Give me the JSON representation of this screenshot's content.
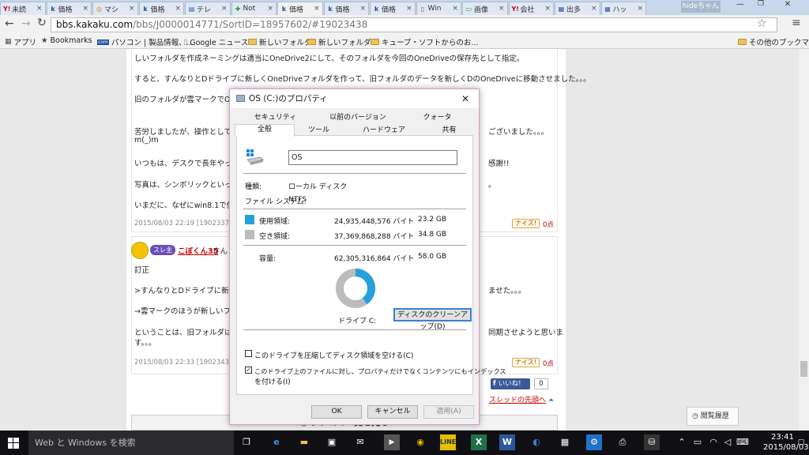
{
  "browser": {
    "tabs": [
      {
        "label": "未読",
        "favicon": "Y!",
        "color": "#d0021b"
      },
      {
        "label": "価格",
        "favicon": "k",
        "color": "#1a4fa0"
      },
      {
        "label": "マシ",
        "favicon": "◎",
        "color": "#e07b00"
      },
      {
        "label": "価格",
        "favicon": "k",
        "color": "#1a4fa0"
      },
      {
        "label": "テレ",
        "favicon": "▤",
        "color": "#2b64b8"
      },
      {
        "label": "Not",
        "favicon": "✚",
        "color": "#2a9d3a"
      },
      {
        "label": "価格",
        "favicon": "k",
        "color": "#1a4fa0"
      },
      {
        "label": "価格",
        "favicon": "k",
        "color": "#1a4fa0"
      },
      {
        "label": "価格",
        "favicon": "k",
        "color": "#1a4fa0"
      },
      {
        "label": "Win",
        "favicon": "▯",
        "color": "#666666"
      },
      {
        "label": "画像",
        "favicon": "▭",
        "color": "#2a9d3a"
      },
      {
        "label": "会社",
        "favicon": "Y!",
        "color": "#d0021b"
      },
      {
        "label": "出多",
        "favicon": "▦",
        "color": "#3355aa"
      },
      {
        "label": "ハッ",
        "favicon": "▦",
        "color": "#3355aa"
      }
    ],
    "active_tab_index": 6,
    "profile_name": "hideちゃん",
    "url_host": "bbs.kakaku.com",
    "url_path": "/bbs/J0000014771/SortID=18957602/#19023438",
    "bookmarks": [
      "アプリ",
      "Bookmarks",
      "パソコン | 製品情報、...",
      "Google ニュース",
      "新しいフォルダ",
      "新しいフォルダ2",
      "キューブ・ソフトからのお...",
      "その他のブックマーク"
    ]
  },
  "page": {
    "post1": {
      "lines": [
        "しいフォルダを作成ネーミングは適当にOneDrive2にして、そのフォルダを今回のOneDriveの保存先として指定。",
        "すると、すんなりとDドライブに新しくOneDriveフォルダを作って、旧フォルダのデータを新しくDのOneDriveに移動させました。。。",
        "旧のフォルダが雲マークでOne",
        "苦労しましたが、操作としては",
        "m(_)m",
        "いつもは、デスクで長年やって",
        "写真は、シンボリックといってい",
        "いまだに、なぜにwin8.1で使え"
      ],
      "line1_tail": "ございました。。。",
      "line2_tail": "感謝!!",
      "line3_tail": "。",
      "meta": "2015/08/03 22:19 [19023379]",
      "nice_label": "ナイス!",
      "nice_count": "0点"
    },
    "post2": {
      "badge": "スレ主",
      "author": "こぼくん35",
      "author_suffix": "さん",
      "lines": [
        "訂正",
        ">すんなりとDドライブに新しく",
        "→雲マークのほうが新しいフォ",
        "ということは、旧フォルダはデ",
        "す。。。"
      ],
      "line1_tail": "ませた。。。",
      "line3_tail": "同期させようと思いま",
      "meta": "2015/08/03 22:33 [19023438]",
      "nice_label": "ナイス!",
      "nice_count": "0点",
      "like_label": "いいね!",
      "like_count": "0",
      "thread_top": "スレッドの先頭へ"
    },
    "kuchikomi": "クチコミ一覧を見る",
    "history": "閲覧履歴"
  },
  "dialog": {
    "title": "OS (C:)のプロパティ",
    "tabs_row1": [
      "セキュリティ",
      "以前のバージョン",
      "クォータ"
    ],
    "tabs_row2": [
      "全般",
      "ツール",
      "ハードウェア",
      "共有"
    ],
    "volume_name": "OS",
    "type_label": "種類:",
    "type_value": "ローカル ディスク",
    "fs_label": "ファイル システム:",
    "fs_value": "NTFS",
    "used_label": "使用領域:",
    "used_bytes": "24,935,448,576 バイト",
    "used_gb": "23.2 GB",
    "free_label": "空き領域:",
    "free_bytes": "37,369,868,288 バイト",
    "free_gb": "34.8 GB",
    "cap_label": "容量:",
    "cap_bytes": "62,305,316,864 バイト",
    "cap_gb": "58.0 GB",
    "used_fraction": 0.4,
    "used_color": "#26a0da",
    "free_color": "#bcbcbc",
    "drive_label": "ドライブ C:",
    "cleanup_button": "ディスクのクリーンアップ(D)",
    "compress_check": "このドライブを圧縮してディスク領域を空ける(C)",
    "index_check_line1": "このドライブ上のファイルに対し、プロパティだけでなくコンテンツにもインデックス",
    "index_check_line2": "を付ける(I)",
    "ok": "OK",
    "cancel": "キャンセル",
    "apply": "適用(A)"
  },
  "taskbar": {
    "search_placeholder": "Web と Windows を検索",
    "time": "23:41",
    "date": "2015/08/03"
  }
}
